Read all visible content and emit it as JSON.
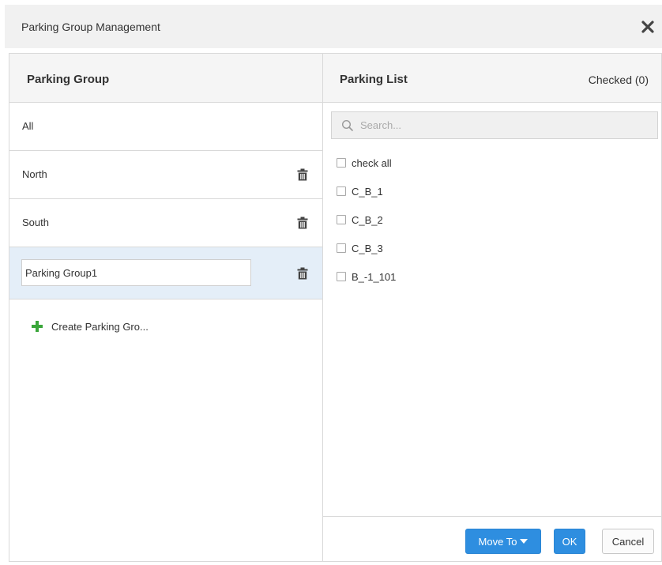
{
  "dialog": {
    "title": "Parking Group Management"
  },
  "left": {
    "title": "Parking Group",
    "groups": [
      {
        "label": "All"
      },
      {
        "label": "North"
      },
      {
        "label": "South"
      }
    ],
    "editing_value": "Parking Group1",
    "create_label": "Create Parking Gro..."
  },
  "right": {
    "title": "Parking List",
    "checked": "Checked (0)",
    "search_placeholder": "Search...",
    "check_all": "check all",
    "items": [
      {
        "label": "C_B_1"
      },
      {
        "label": "C_B_2"
      },
      {
        "label": "C_B_3"
      },
      {
        "label": "B_-1_101"
      }
    ]
  },
  "footer": {
    "move_to": "Move To",
    "ok": "OK",
    "cancel": "Cancel"
  },
  "colors": {
    "primary": "#2e8ee0",
    "selected_row": "#e4eef8",
    "create_icon": "#3aa63a"
  }
}
